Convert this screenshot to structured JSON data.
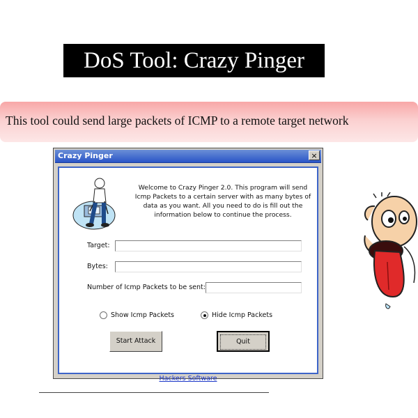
{
  "slide": {
    "title": "DoS Tool: Crazy Pinger",
    "banner_text": "This tool could send large packets of ICMP to a remote target network"
  },
  "window": {
    "title": "Crazy Pinger",
    "close_glyph": "×",
    "welcome_text": "Welcome to Crazy Pinger 2.0. This program will send Icmp Packets to a certain server with as many bytes of data as you want. All you need to do is fill out the information below to continue the process.",
    "fields": {
      "target_label": "Target:",
      "target_value": "",
      "bytes_label": "Bytes:",
      "bytes_value": "",
      "packets_label": "Number of Icmp Packets to be sent:",
      "packets_value": ""
    },
    "radios": {
      "show_label": "Show Icmp Packets",
      "show_selected": false,
      "hide_label": "Hide Icmp Packets",
      "hide_selected": true
    },
    "buttons": {
      "start_label": "Start Attack",
      "quit_label": "Quit"
    },
    "link_text": "Hackers Software"
  },
  "colors": {
    "titlebar": "#2a55c8",
    "client_border": "#3d64c8",
    "banner": "#f8a7a7",
    "link": "#1a36c8"
  }
}
